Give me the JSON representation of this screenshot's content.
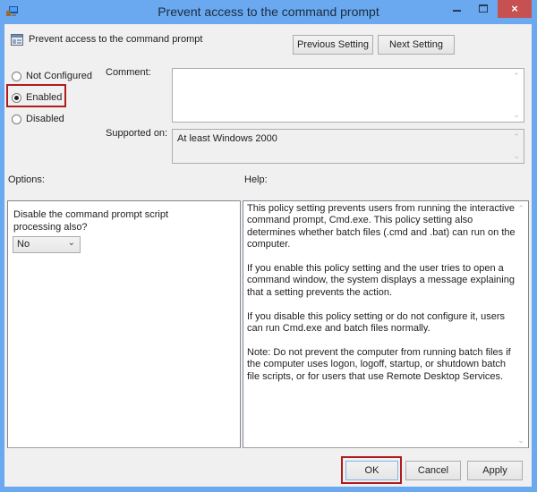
{
  "window": {
    "title": "Prevent access to the command prompt",
    "controls": {
      "minimize": "minimize",
      "maximize": "maximize",
      "close": "×"
    }
  },
  "header": {
    "policy_name": "Prevent access to the command prompt",
    "previous_label": "Previous Setting",
    "next_label": "Next Setting"
  },
  "state": {
    "options": [
      {
        "label": "Not Configured",
        "checked": false
      },
      {
        "label": "Enabled",
        "checked": true
      },
      {
        "label": "Disabled",
        "checked": false
      }
    ],
    "highlighted": "Enabled"
  },
  "comment": {
    "label": "Comment:",
    "value": ""
  },
  "supported": {
    "label": "Supported on:",
    "value": "At least Windows 2000"
  },
  "options_panel": {
    "label": "Options:",
    "question": "Disable the command prompt script processing also?",
    "select_value": "No"
  },
  "help_panel": {
    "label": "Help:",
    "paragraphs": [
      "This policy setting prevents users from running the interactive command prompt, Cmd.exe.  This policy setting also determines whether batch files (.cmd and .bat) can run on the computer.",
      "If you enable this policy setting and the user tries to open a command window, the system displays a message explaining that a setting prevents the action.",
      "If you disable this policy setting or do not configure it, users can run Cmd.exe and batch files normally.",
      "Note: Do not prevent the computer from running batch files if the computer uses logon, logoff, startup, or shutdown batch file scripts, or for users that use Remote Desktop Services."
    ]
  },
  "footer": {
    "ok_label": "OK",
    "cancel_label": "Cancel",
    "apply_label": "Apply"
  },
  "colors": {
    "titlebar": "#6aa9f0",
    "close": "#c75050",
    "highlight": "#b01c1c",
    "client": "#f0f0f0"
  }
}
